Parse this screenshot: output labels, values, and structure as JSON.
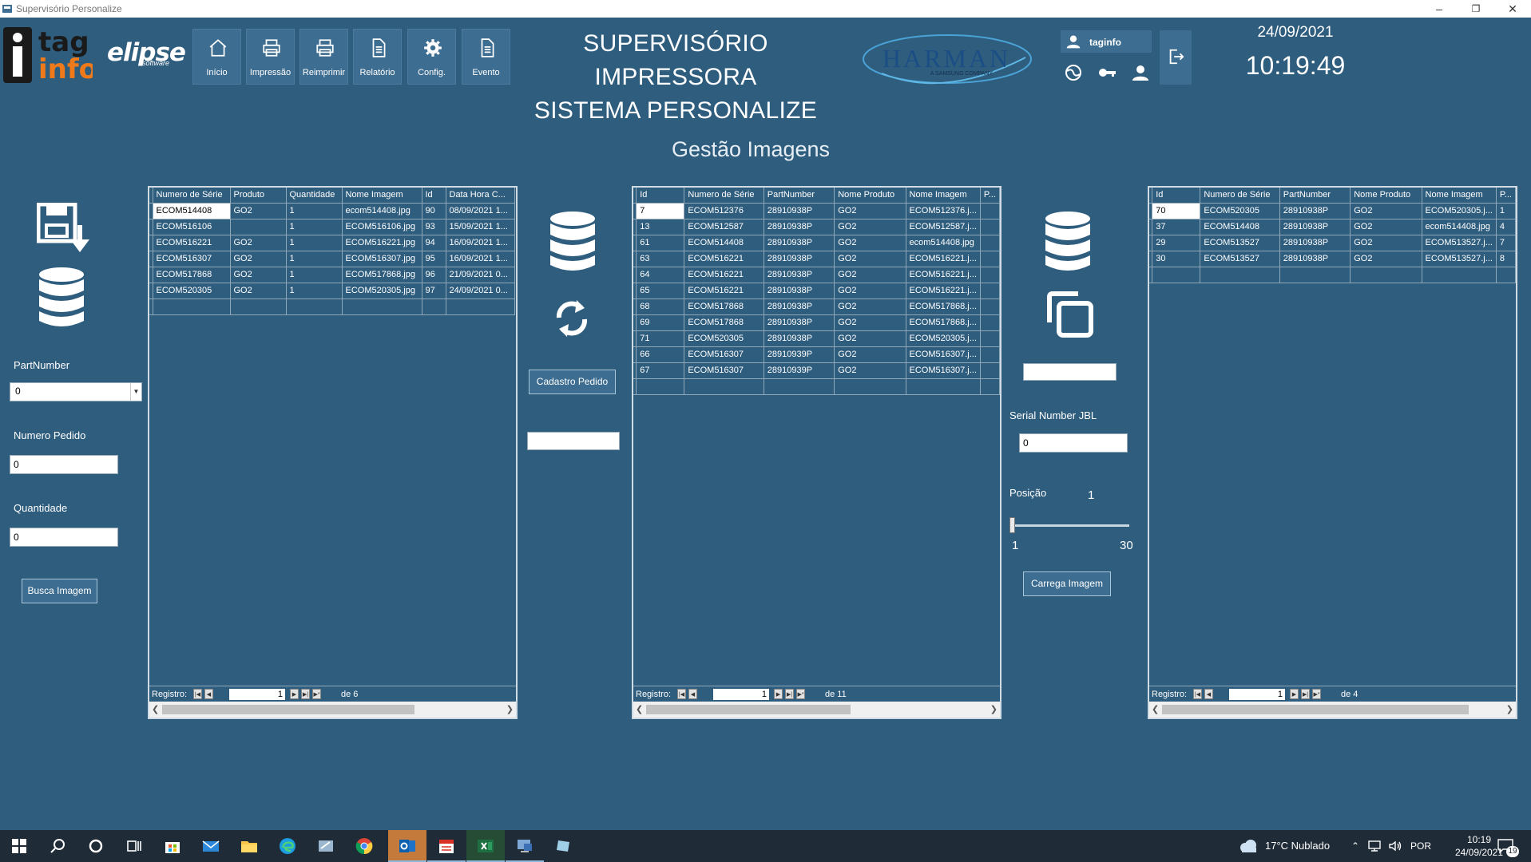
{
  "window": {
    "title": "Supervisório Personalize"
  },
  "logos": {
    "tag_top": "tag",
    "tag_bottom": "info",
    "elipse": "elipse",
    "elipse_sub": "software",
    "harman": "HARMAN",
    "harman_sub": "A SAMSUNG COMPANY"
  },
  "nav": [
    {
      "label": "Início",
      "icon": "home-icon"
    },
    {
      "label": "Impressão",
      "icon": "printer-icon"
    },
    {
      "label": "Reimprimir",
      "icon": "printer-icon"
    },
    {
      "label": "Relatório",
      "icon": "document-icon"
    },
    {
      "label": "Config.",
      "icon": "gear-icon"
    },
    {
      "label": "Evento",
      "icon": "document-icon"
    }
  ],
  "header": {
    "title_line1": "SUPERVISÓRIO IMPRESSORA",
    "title_line2": "SISTEMA PERSONALIZE"
  },
  "user": {
    "name": "taginfo"
  },
  "datetime": {
    "date": "24/09/2021",
    "time": "10:19:49"
  },
  "page": {
    "title": "Gestão Imagens"
  },
  "left_form": {
    "partnumber_label": "PartNumber",
    "partnumber_value": "0",
    "pedido_label": "Numero Pedido",
    "pedido_value": "0",
    "quantidade_label": "Quantidade",
    "quantidade_value": "0",
    "busca_button": "Busca Imagem"
  },
  "grid1": {
    "columns": [
      "Numero de Série",
      "Produto",
      "Quantidade",
      "Nome Imagem",
      "Id",
      "Data Hora C..."
    ],
    "rows": [
      [
        "ECOM514408",
        "GO2",
        "1",
        "ecom514408.jpg",
        "90",
        "08/09/2021 1..."
      ],
      [
        "ECOM516106",
        "",
        "1",
        "ECOM516106.jpg",
        "93",
        "15/09/2021 1..."
      ],
      [
        "ECOM516221",
        "GO2",
        "1",
        "ECOM516221.jpg",
        "94",
        "16/09/2021 1..."
      ],
      [
        "ECOM516307",
        "GO2",
        "1",
        "ECOM516307.jpg",
        "95",
        "16/09/2021 1..."
      ],
      [
        "ECOM517868",
        "GO2",
        "1",
        "ECOM517868.jpg",
        "96",
        "21/09/2021 0..."
      ],
      [
        "ECOM520305",
        "GO2",
        "1",
        "ECOM520305.jpg",
        "97",
        "24/09/2021 0..."
      ]
    ],
    "nav_label": "Registro:",
    "position": "1",
    "of_text": "de 6"
  },
  "middle": {
    "cadastro_button": "Cadastro Pedido"
  },
  "grid2": {
    "columns": [
      "Id",
      "Numero de Série",
      "PartNumber",
      "Nome Produto",
      "Nome Imagem",
      "P..."
    ],
    "rows": [
      [
        "7",
        "ECOM512376",
        "28910938P",
        "GO2",
        "ECOM512376.j...",
        ""
      ],
      [
        "13",
        "ECOM512587",
        "28910938P",
        "GO2",
        "ECOM512587.j...",
        ""
      ],
      [
        "61",
        "ECOM514408",
        "28910938P",
        "GO2",
        "ecom514408.jpg",
        ""
      ],
      [
        "63",
        "ECOM516221",
        "28910938P",
        "GO2",
        "ECOM516221.j...",
        ""
      ],
      [
        "64",
        "ECOM516221",
        "28910938P",
        "GO2",
        "ECOM516221.j...",
        ""
      ],
      [
        "65",
        "ECOM516221",
        "28910938P",
        "GO2",
        "ECOM516221.j...",
        ""
      ],
      [
        "68",
        "ECOM517868",
        "28910938P",
        "GO2",
        "ECOM517868.j...",
        ""
      ],
      [
        "69",
        "ECOM517868",
        "28910938P",
        "GO2",
        "ECOM517868.j...",
        ""
      ],
      [
        "71",
        "ECOM520305",
        "28910938P",
        "GO2",
        "ECOM520305.j...",
        ""
      ],
      [
        "66",
        "ECOM516307",
        "28910939P",
        "GO2",
        "ECOM516307.j...",
        ""
      ],
      [
        "67",
        "ECOM516307",
        "28910939P",
        "GO2",
        "ECOM516307.j...",
        ""
      ]
    ],
    "nav_label": "Registro:",
    "position": "1",
    "of_text": "de 11"
  },
  "right_form": {
    "serial_label": "Serial Number JBL",
    "serial_value": "0",
    "posicao_label": "Posição",
    "posicao_value": "1",
    "slider_min": "1",
    "slider_max": "30",
    "slider_level": 1,
    "carrega_button": "Carrega Imagem"
  },
  "grid3": {
    "columns": [
      "Id",
      "Numero de Série",
      "PartNumber",
      "Nome Produto",
      "Nome Imagem",
      "P..."
    ],
    "rows": [
      [
        "70",
        "ECOM520305",
        "28910938P",
        "GO2",
        "ECOM520305.j...",
        "1"
      ],
      [
        "37",
        "ECOM514408",
        "28910938P",
        "GO2",
        "ecom514408.jpg",
        "4"
      ],
      [
        "29",
        "ECOM513527",
        "28910938P",
        "GO2",
        "ECOM513527.j...",
        "7"
      ],
      [
        "30",
        "ECOM513527",
        "28910938P",
        "GO2",
        "ECOM513527.j...",
        "8"
      ]
    ],
    "nav_label": "Registro:",
    "position": "1",
    "of_text": "de 4"
  },
  "taskbar": {
    "weather": "17°C  Nublado",
    "lang": "POR",
    "time": "10:19",
    "date": "24/09/2021",
    "notifications": "19"
  }
}
